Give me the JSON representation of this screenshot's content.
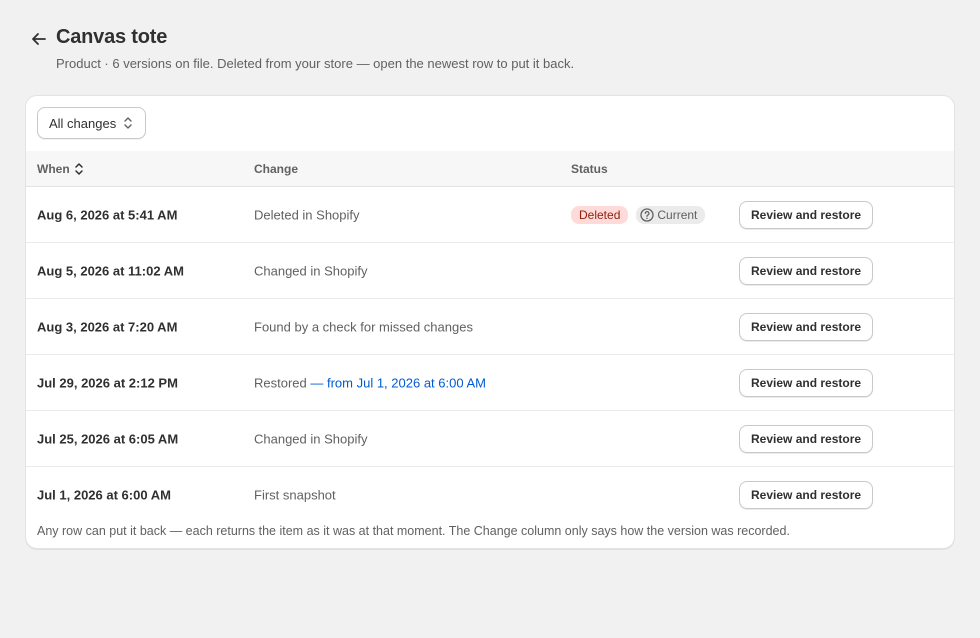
{
  "header": {
    "title": "Canvas tote",
    "subtitle": "Product · 6 versions on file. Deleted from your store — open the newest row to put it back."
  },
  "filter": {
    "label": "All changes"
  },
  "table": {
    "columns": {
      "when": "When",
      "change": "Change",
      "status": "Status"
    },
    "rows": [
      {
        "when": "Aug 6, 2026 at 5:41 AM",
        "change": "Deleted in Shopify",
        "change_link": "",
        "status_deleted": "Deleted",
        "status_current": "Current",
        "action": "Review and restore"
      },
      {
        "when": "Aug 5, 2026 at 11:02 AM",
        "change": "Changed in Shopify",
        "change_link": "",
        "status_deleted": "",
        "status_current": "",
        "action": "Review and restore"
      },
      {
        "when": "Aug 3, 2026 at 7:20 AM",
        "change": "Found by a check for missed changes",
        "change_link": "",
        "status_deleted": "",
        "status_current": "",
        "action": "Review and restore"
      },
      {
        "when": "Jul 29, 2026 at 2:12 PM",
        "change": "Restored",
        "change_link": "— from Jul 1, 2026 at 6:00 AM",
        "status_deleted": "",
        "status_current": "",
        "action": "Review and restore"
      },
      {
        "when": "Jul 25, 2026 at 6:05 AM",
        "change": "Changed in Shopify",
        "change_link": "",
        "status_deleted": "",
        "status_current": "",
        "action": "Review and restore"
      },
      {
        "when": "Jul 1, 2026 at 6:00 AM",
        "change": "First snapshot",
        "change_link": "",
        "status_deleted": "",
        "status_current": "",
        "action": "Review and restore"
      }
    ]
  },
  "footnote": "Any row can put it back — each returns the item as it was at that moment. The Change column only says how the version was recorded.",
  "colors": {
    "accent_link": "#005bd3",
    "deleted_badge_bg": "#fedad9",
    "deleted_badge_text": "#8e1f0b",
    "current_badge_bg": "#ebebeb"
  },
  "icons": {
    "back": "arrow-left-icon",
    "filter": "chevron-up-down-icon",
    "sort": "sort-icon",
    "current": "question-circle-icon"
  }
}
